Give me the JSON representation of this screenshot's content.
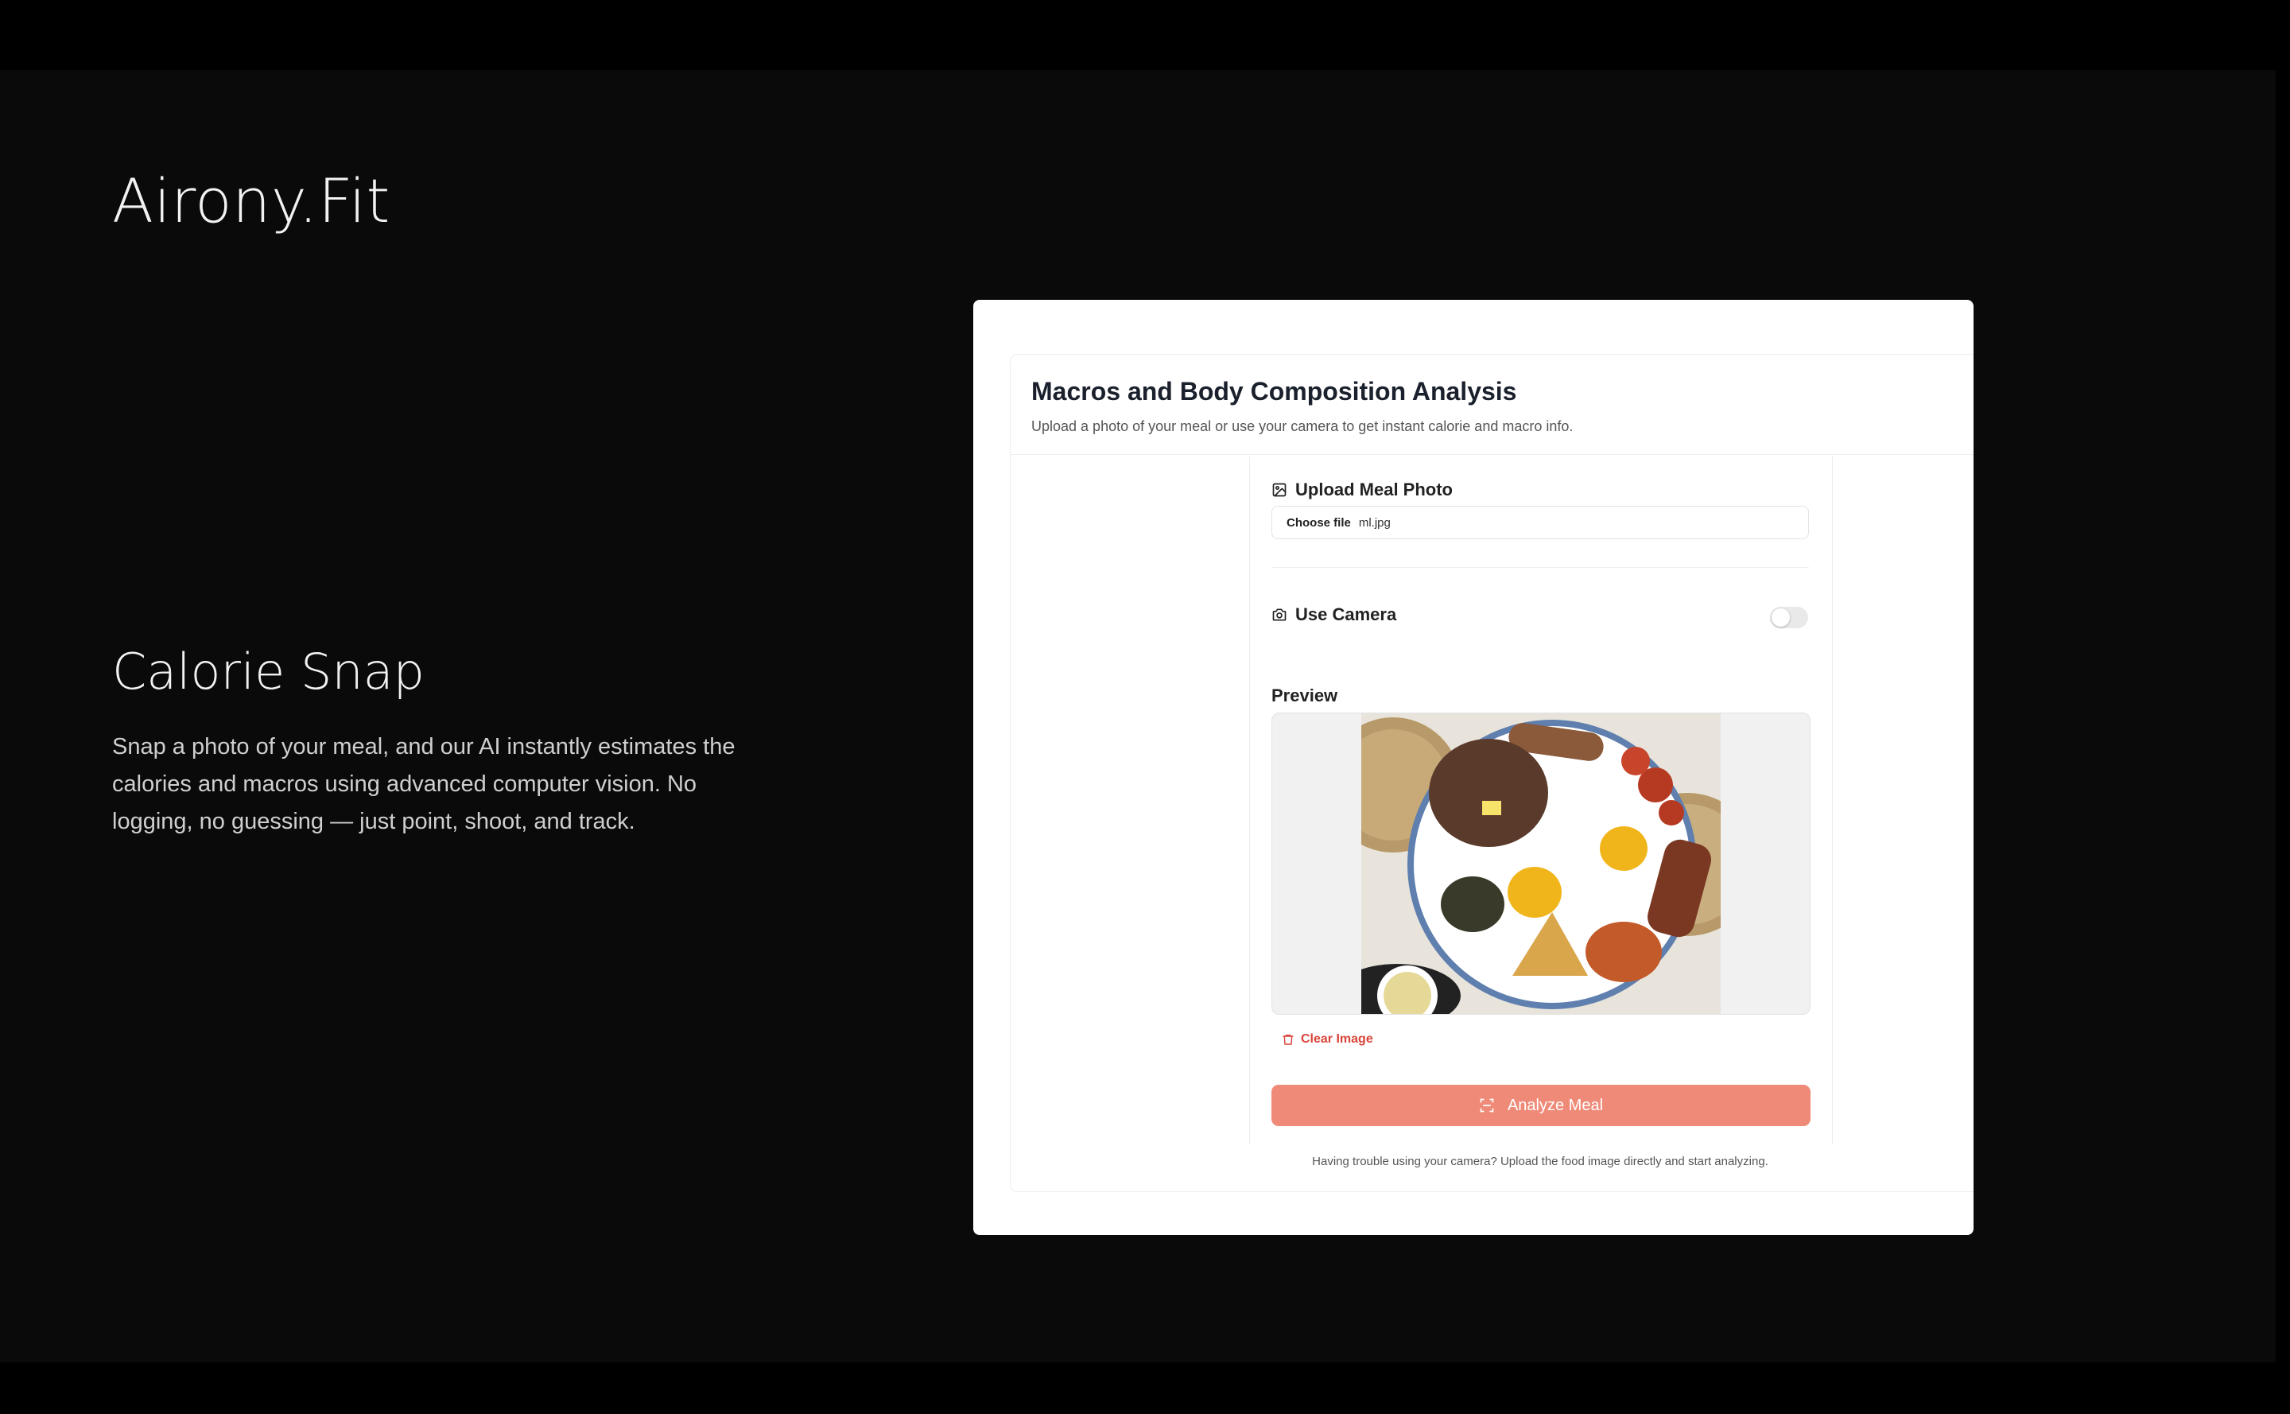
{
  "brand": "Airony.Fit",
  "feature": {
    "title": "Calorie Snap",
    "description": "Snap a photo of your meal, and our AI instantly estimates the calories and macros using advanced computer vision. No logging, no guessing — just point, shoot, and track."
  },
  "app": {
    "title": "Macros and Body Composition Analysis",
    "subtitle": "Upload a photo of your meal or use your camera to get instant calorie and macro info.",
    "upload": {
      "label": "Upload Meal Photo",
      "icon": "image-icon",
      "button_label": "Choose file",
      "file_name": "ml.jpg"
    },
    "camera": {
      "label": "Use Camera",
      "icon": "camera-icon",
      "enabled": false
    },
    "preview": {
      "title": "Preview"
    },
    "clear_label": "Clear Image",
    "analyze_label": "Analyze Meal",
    "help_text": "Having trouble using your camera? Upload the food image directly and start analyzing."
  },
  "colors": {
    "accent": "#ef8a78",
    "danger": "#d9453b",
    "background": "#0a0a0a"
  }
}
